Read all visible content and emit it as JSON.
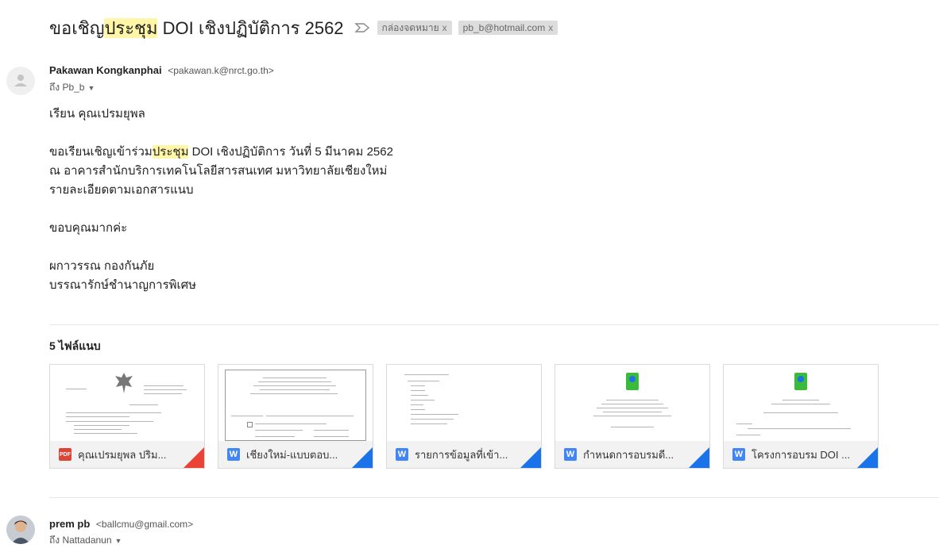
{
  "thread": {
    "subject_pre": "ขอเชิญ",
    "subject_highlight": "ประชุม",
    "subject_post": " DOI เชิงปฏิบัติการ 2562",
    "importance_icon": "importance-arrow-icon",
    "labels": [
      {
        "text": "กล่องจดหมาย",
        "close": "x"
      },
      {
        "text": "pb_b@hotmail.com",
        "close": "x"
      }
    ]
  },
  "message1": {
    "sender_name": "Pakawan Kongkanphai",
    "sender_email": "<pakawan.k@nrct.go.th>",
    "to": "ถึง Pb_b",
    "avatar_icon": "default-person-icon",
    "body": {
      "greeting": "เรียน  คุณเปรมยุพล",
      "line1_pre": "ขอเรียนเชิญเข้าร่วม",
      "line1_highlight": "ประชุม",
      "line1_post": " DOI เชิงปฏิบัติการ วันที่ 5 มีนาคม 2562",
      "line2": "ณ อาคารสำนักบริการเทคโนโลยีสารสนเทศ มหาวิทยาลัยเชียงใหม่",
      "line3": "รายละเอียดตามเอกสารแนบ",
      "thanks": "ขอบคุณมากค่ะ",
      "sig_name": "ผกาวรรณ กองกันภัย",
      "sig_title": "บรรณารักษ์ชำนาญการพิเศษ"
    },
    "attachments_title": "5 ไฟล์แนบ",
    "attachments": [
      {
        "name": "คุณเปรมยุพล ปริม...",
        "type": "pdf",
        "type_label": "PDF"
      },
      {
        "name": "เชียงใหม่-แบบตอบ...",
        "type": "doc",
        "type_label": "W"
      },
      {
        "name": "รายการข้อมูลที่เข้า...",
        "type": "doc",
        "type_label": "W"
      },
      {
        "name": "กำหนดการอบรมดี...",
        "type": "doc",
        "type_label": "W"
      },
      {
        "name": "โครงการอบรม DOI ...",
        "type": "doc",
        "type_label": "W"
      }
    ]
  },
  "message2": {
    "sender_name": "prem pb",
    "sender_email": "<ballcmu@gmail.com>",
    "to": "ถึง Nattadanun",
    "avatar_icon": "user-photo-icon"
  },
  "colors": {
    "highlight": "#fff6a8",
    "pdf": "#db4437",
    "doc": "#4285f4"
  }
}
